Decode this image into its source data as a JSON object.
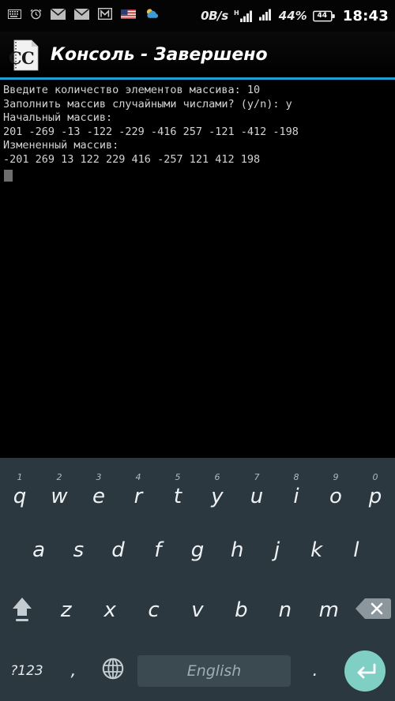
{
  "status_bar": {
    "icons": [
      {
        "name": "keyboard-icon",
        "glyph": "keyboard"
      },
      {
        "name": "alarm-clock-icon",
        "glyph": "alarm"
      },
      {
        "name": "mail-icon-1",
        "glyph": "envelope"
      },
      {
        "name": "mail-icon-2",
        "glyph": "envelope"
      },
      {
        "name": "gmail-icon",
        "glyph": "gmail"
      },
      {
        "name": "flag-icon",
        "glyph": "us-flag"
      },
      {
        "name": "weather-icon",
        "glyph": "cloud-sun"
      }
    ],
    "network_speed": "0B/s",
    "signal_superscript": "H",
    "battery_percent": "44%",
    "battery_level_label": "44",
    "clock": "18:43"
  },
  "title_bar": {
    "app_icon_name": "c-cpp-document-icon",
    "icon_letters": "C C",
    "title": "Консоль - Завершено",
    "accent_color": "#1f9fd8"
  },
  "console": {
    "background": "#000000",
    "text_color": "#d3d3d3",
    "lines": [
      "Введите количество элементов массива: 10",
      "Заполнить массив случайными числами? (y/n): y",
      "Начальный массив:",
      "201 -269 -13 -122 -229 -416 257 -121 -412 -198",
      "Измененный массив:",
      "-201 269 13 122 229 416 -257 121 412 198"
    ],
    "prompts": {
      "count_prompt": "Введите количество элементов массива:",
      "count_value": "10",
      "random_prompt": "Заполнить массив случайными числами? (y/n):",
      "random_value": "y",
      "initial_label": "Начальный массив:",
      "modified_label": "Измененный массив:"
    },
    "initial_array": [
      201,
      -269,
      -13,
      -122,
      -229,
      -416,
      257,
      -121,
      -412,
      -198
    ],
    "modified_array": [
      -201,
      269,
      13,
      122,
      229,
      416,
      -257,
      121,
      412,
      198
    ],
    "cursor_visible": true
  },
  "keyboard": {
    "background": "#2b383f",
    "enter_color": "#7fcfc4",
    "row1": [
      {
        "letter": "q",
        "num": "1"
      },
      {
        "letter": "w",
        "num": "2"
      },
      {
        "letter": "e",
        "num": "3"
      },
      {
        "letter": "r",
        "num": "4"
      },
      {
        "letter": "t",
        "num": "5"
      },
      {
        "letter": "y",
        "num": "6"
      },
      {
        "letter": "u",
        "num": "7"
      },
      {
        "letter": "i",
        "num": "8"
      },
      {
        "letter": "o",
        "num": "9"
      },
      {
        "letter": "p",
        "num": "0"
      }
    ],
    "row2": [
      {
        "letter": "a"
      },
      {
        "letter": "s"
      },
      {
        "letter": "d"
      },
      {
        "letter": "f"
      },
      {
        "letter": "g"
      },
      {
        "letter": "h"
      },
      {
        "letter": "j"
      },
      {
        "letter": "k"
      },
      {
        "letter": "l"
      }
    ],
    "row3": {
      "shift_name": "shift-key",
      "letters": [
        {
          "letter": "z"
        },
        {
          "letter": "x"
        },
        {
          "letter": "c"
        },
        {
          "letter": "v"
        },
        {
          "letter": "b"
        },
        {
          "letter": "n"
        },
        {
          "letter": "m"
        }
      ],
      "backspace_name": "backspace-key"
    },
    "row4": {
      "symbols_label": "?123",
      "comma_label": ",",
      "globe_name": "language-globe-key",
      "space_label": "English",
      "period_label": ".",
      "enter_name": "enter-key"
    }
  }
}
